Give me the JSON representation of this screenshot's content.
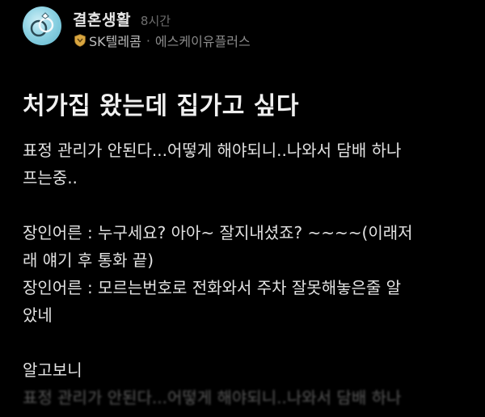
{
  "post": {
    "board_name": "결혼생활",
    "time_ago": "8시간",
    "company": "SK텔레콤",
    "separator": "·",
    "nickname": "에스케이유플러스",
    "title": "처가집 왔는데 집가고 싶다",
    "body_lines": [
      "표정 관리가 안된다...어떻게 해야되니..나와서 담배 하나",
      "프는중..",
      "",
      "장인어른 : 누구세요? 아아~ 잘지내셨죠? ~~~~(이래저",
      "래 얘기 후 통화 끝)",
      "장인어른 : 모르는번호로 전화와서 주차 잘못해놓은줄 알",
      "았네",
      "",
      "알고보니",
      "표정 관리가 안된다...어떻게 해야되니..나와서 담배 하나"
    ]
  },
  "colors": {
    "background": "#000000",
    "title": "#f0f0f0",
    "text": "#e2e2e2",
    "muted": "#6f6f6f",
    "badge": "#d9a640"
  },
  "icons": {
    "avatar": "wedding-rings-avatar",
    "badge": "shield-icon"
  }
}
